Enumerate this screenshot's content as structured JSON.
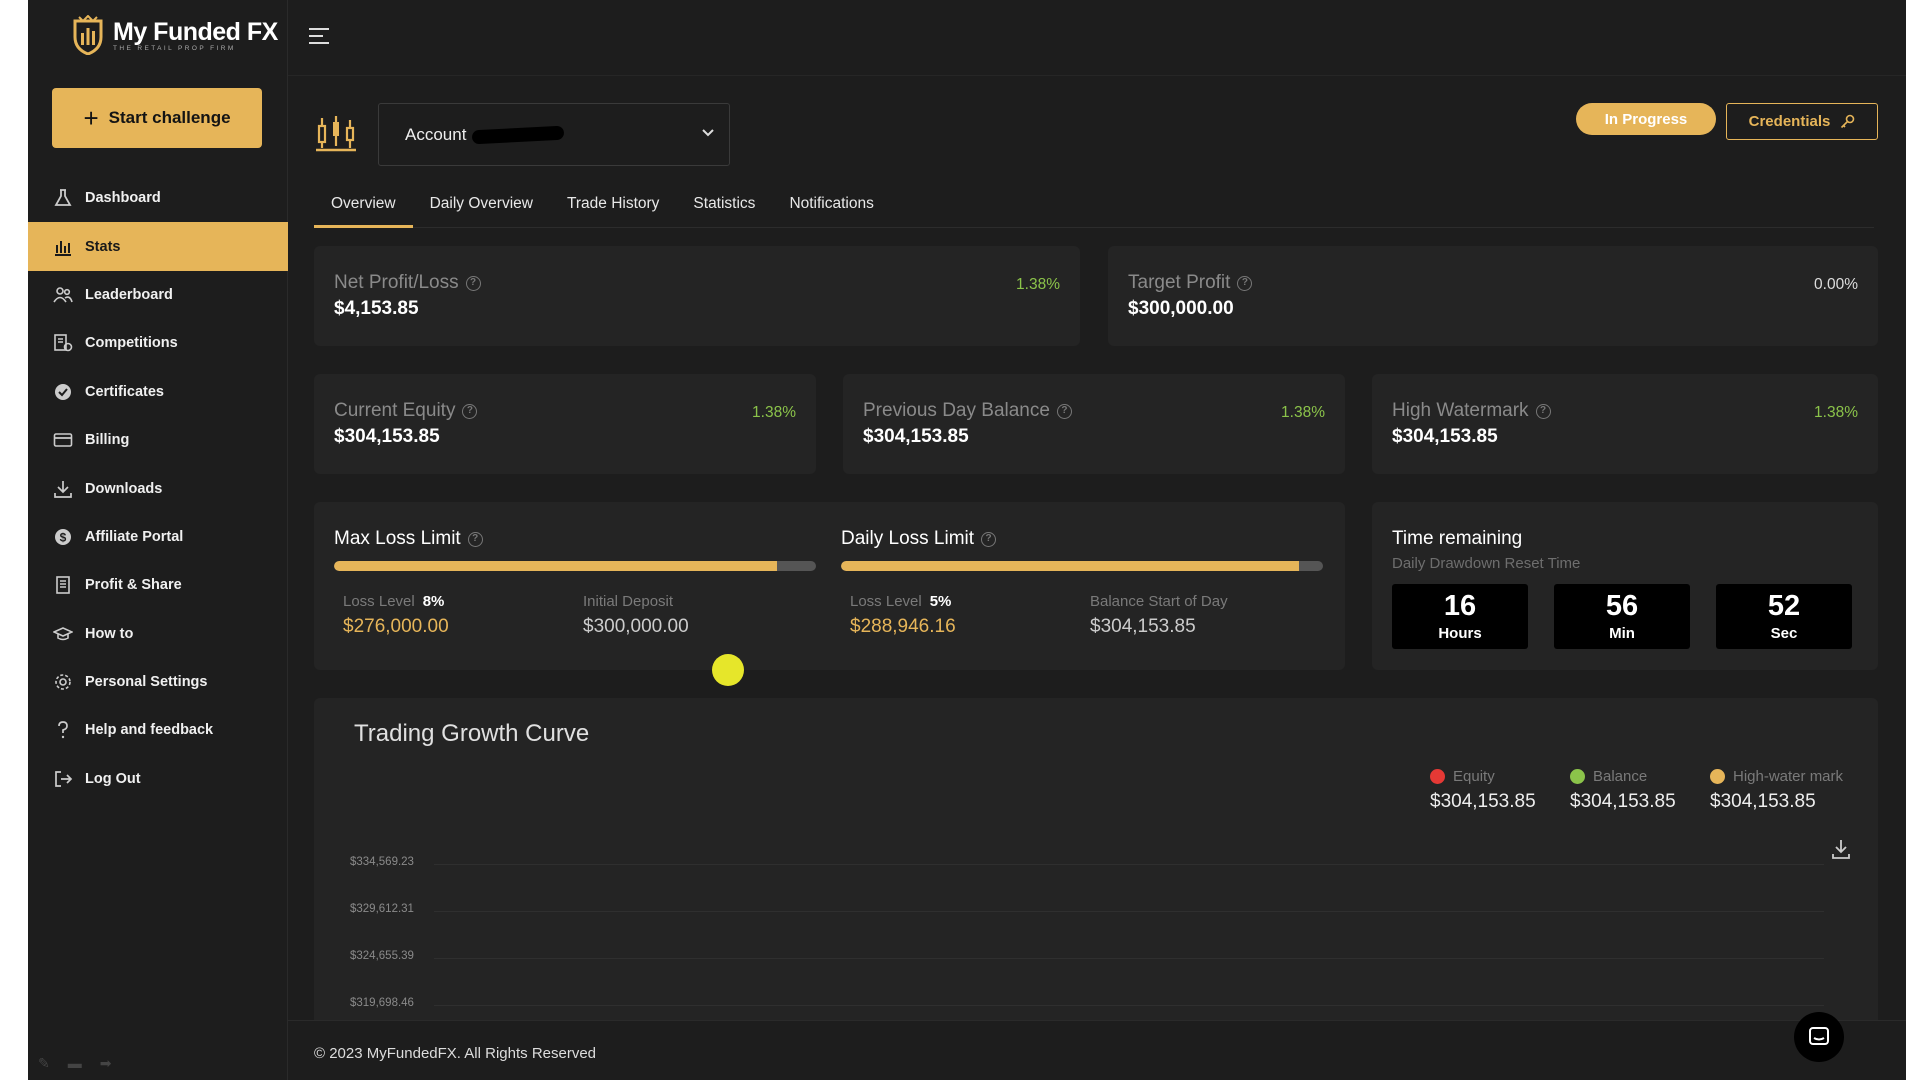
{
  "brand": {
    "name": "My Funded FX",
    "tagline": "THE RETAIL PROP FIRM"
  },
  "sidebar": {
    "start_label": "Start challenge",
    "items": [
      {
        "label": "Dashboard",
        "icon": "flask-icon"
      },
      {
        "label": "Stats",
        "icon": "stats-chart-icon",
        "active": true
      },
      {
        "label": "Leaderboard",
        "icon": "users-icon"
      },
      {
        "label": "Competitions",
        "icon": "competition-icon"
      },
      {
        "label": "Certificates",
        "icon": "badge-check-icon"
      },
      {
        "label": "Billing",
        "icon": "credit-card-icon"
      },
      {
        "label": "Downloads",
        "icon": "download-icon"
      },
      {
        "label": "Affiliate Portal",
        "icon": "dollar-icon"
      },
      {
        "label": "Profit & Share",
        "icon": "receipt-icon"
      },
      {
        "label": "How to",
        "icon": "graduation-cap-icon"
      },
      {
        "label": "Personal Settings",
        "icon": "gear-icon"
      },
      {
        "label": "Help and feedback",
        "icon": "question-icon"
      },
      {
        "label": "Log Out",
        "icon": "logout-icon"
      }
    ]
  },
  "header": {
    "account_label": "Account",
    "status": "In Progress",
    "credentials": "Credentials"
  },
  "tabs": [
    "Overview",
    "Daily Overview",
    "Trade History",
    "Statistics",
    "Notifications"
  ],
  "stats": {
    "net": {
      "title": "Net Profit/Loss",
      "value": "$4,153.85",
      "pct": "1.38%"
    },
    "target": {
      "title": "Target Profit",
      "value": "$300,000.00",
      "pct": "0.00%"
    },
    "equity": {
      "title": "Current Equity",
      "value": "$304,153.85",
      "pct": "1.38%"
    },
    "prev": {
      "title": "Previous Day Balance",
      "value": "$304,153.85",
      "pct": "1.38%"
    },
    "hwm": {
      "title": "High Watermark",
      "value": "$304,153.85",
      "pct": "1.38%"
    }
  },
  "limits": {
    "max": {
      "title": "Max Loss Limit",
      "level_label": "Loss Level",
      "level": "8%",
      "amount": "$276,000.00",
      "ref_label": "Initial Deposit",
      "ref_value": "$300,000.00",
      "fill": 0.92
    },
    "daily": {
      "title": "Daily Loss Limit",
      "level_label": "Loss Level",
      "level": "5%",
      "amount": "$288,946.16",
      "ref_label": "Balance Start of Day",
      "ref_value": "$304,153.85",
      "fill": 0.95
    }
  },
  "time": {
    "title": "Time remaining",
    "subtitle": "Daily Drawdown Reset Time",
    "hours": "16",
    "hours_label": "Hours",
    "min": "56",
    "min_label": "Min",
    "sec": "52",
    "sec_label": "Sec"
  },
  "growth": {
    "title": "Trading Growth Curve",
    "legend": [
      {
        "name": "Equity",
        "value": "$304,153.85",
        "color": "#e53935"
      },
      {
        "name": "Balance",
        "value": "$304,153.85",
        "color": "#8bc34a"
      },
      {
        "name": "High-water mark",
        "value": "$304,153.85",
        "color": "#e6b559"
      }
    ],
    "yticks": [
      "$334,569.23",
      "$329,612.31",
      "$324,655.39",
      "$319,698.46"
    ]
  },
  "footer": {
    "copyright": "© 2023 MyFundedFX. All Rights Reserved"
  },
  "colors": {
    "accent": "#e6b559",
    "positive": "#8bc34a",
    "background": "#1d1d1d",
    "card": "#242424"
  }
}
